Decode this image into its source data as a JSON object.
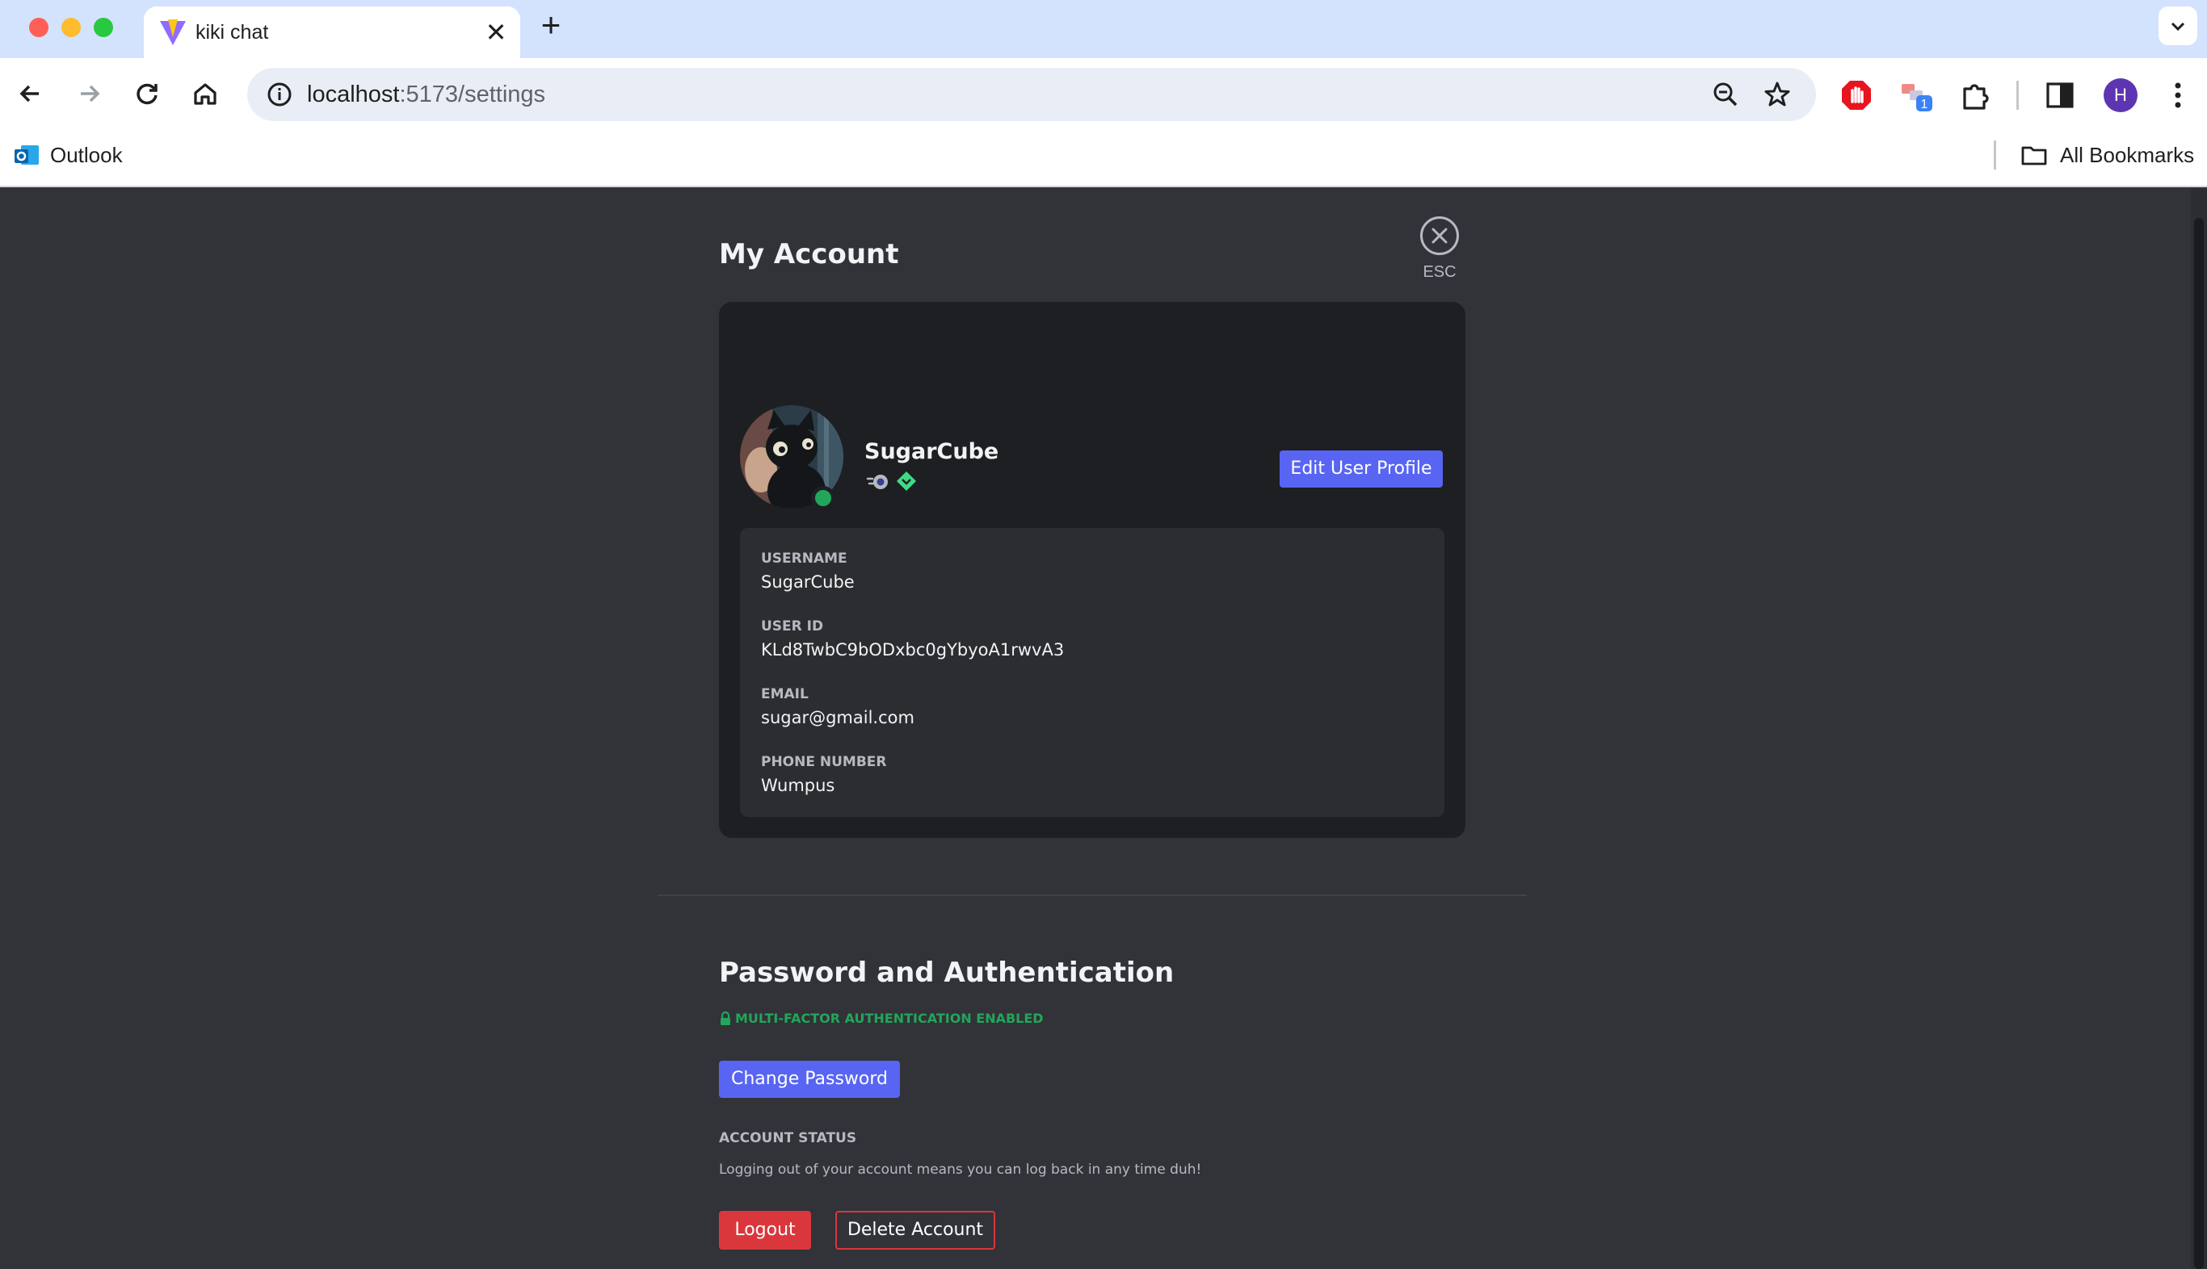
{
  "browser": {
    "tab_title": "kiki chat",
    "tab_close": "✕",
    "new_tab": "+",
    "url_host": "localhost",
    "url_path": ":5173/settings",
    "profile_initial": "H",
    "extension_badge": "1",
    "bookmarks": [
      {
        "label": "Outlook",
        "icon": "outlook-icon"
      },
      {
        "label": "All Bookmarks",
        "icon": "folder-icon"
      }
    ]
  },
  "settings": {
    "title": "My Account",
    "close_label": "ESC",
    "profile": {
      "display_name": "SugarCube",
      "status": "online",
      "status_color": "#23a55a",
      "edit_button": "Edit User Profile",
      "badges": [
        "nitro-badge-icon",
        "boost-badge-icon"
      ]
    },
    "fields": [
      {
        "label": "USERNAME",
        "value": "SugarCube"
      },
      {
        "label": "USER ID",
        "value": "KLd8TwbC9bODxbc0gYbyoA1rwvA3"
      },
      {
        "label": "EMAIL",
        "value": "sugar@gmail.com"
      },
      {
        "label": "PHONE NUMBER",
        "value": "Wumpus"
      }
    ],
    "password_section": {
      "title": "Password and Authentication",
      "mfa_status": "MULTI-FACTOR AUTHENTICATION ENABLED",
      "change_password": "Change Password",
      "account_status_label": "ACCOUNT STATUS",
      "account_status_desc": "Logging out of your account means you can log back in any time duh!",
      "logout": "Logout",
      "delete_account": "Delete Account"
    }
  },
  "colors": {
    "accent": "#5865f2",
    "danger": "#da373c",
    "success": "#23a55a",
    "background": "#313338",
    "card": "#1e1f22"
  }
}
